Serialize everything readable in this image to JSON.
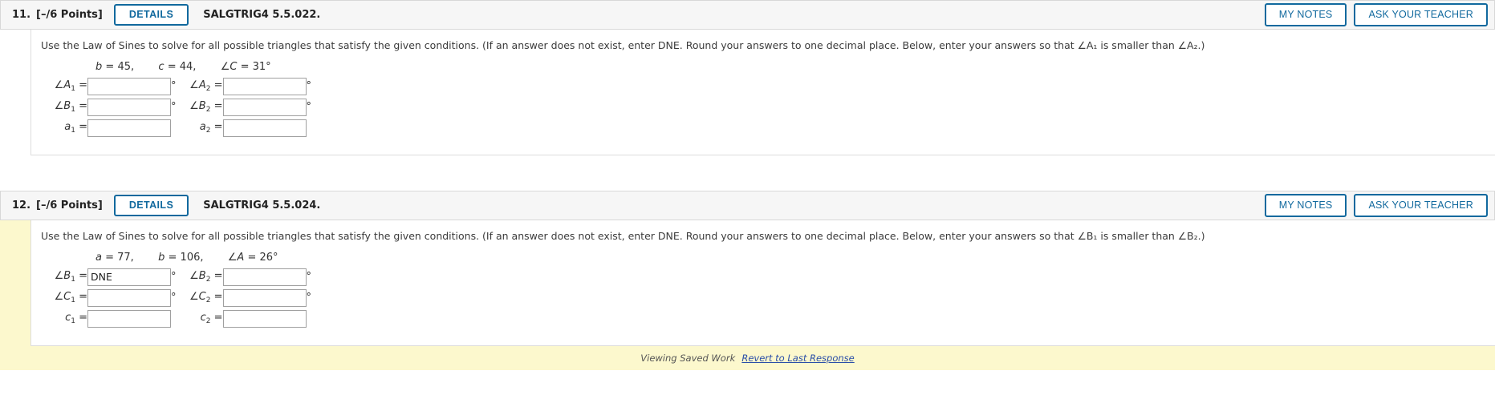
{
  "problems": [
    {
      "number": "11.",
      "points": "[–/6 Points]",
      "details_label": "DETAILS",
      "code": "SALGTRIG4 5.5.022.",
      "my_notes_label": "MY NOTES",
      "ask_teacher_label": "ASK YOUR TEACHER",
      "instructions": "Use the Law of Sines to solve for all possible triangles that satisfy the given conditions. (If an answer does not exist, enter DNE. Round your answers to one decimal place. Below, enter your answers so that ∠A₁ is smaller than ∠A₂.)",
      "given": {
        "v1_name": "b",
        "v1_value": "45,",
        "v2_name": "c",
        "v2_value": "44,",
        "v3_name": "∠C",
        "v3_value": "31°"
      },
      "state": "plain",
      "rows": [
        {
          "left_label_var": "∠A",
          "left_label_sub": "1",
          "left_value": "",
          "left_degree": "°",
          "right_label_var": "∠A",
          "right_label_sub": "2",
          "right_value": "",
          "right_degree": "°"
        },
        {
          "left_label_var": "∠B",
          "left_label_sub": "1",
          "left_value": "",
          "left_degree": "°",
          "right_label_var": "∠B",
          "right_label_sub": "2",
          "right_value": "",
          "right_degree": "°"
        },
        {
          "left_label_var": "a",
          "left_label_sub": "1",
          "left_value": "",
          "left_degree": "",
          "right_label_var": "a",
          "right_label_sub": "2",
          "right_value": "",
          "right_degree": ""
        }
      ],
      "footer": null
    },
    {
      "number": "12.",
      "points": "[–/6 Points]",
      "details_label": "DETAILS",
      "code": "SALGTRIG4 5.5.024.",
      "my_notes_label": "MY NOTES",
      "ask_teacher_label": "ASK YOUR TEACHER",
      "instructions": "Use the Law of Sines to solve for all possible triangles that satisfy the given conditions. (If an answer does not exist, enter DNE. Round your answers to one decimal place. Below, enter your answers so that ∠B₁ is smaller than ∠B₂.)",
      "given": {
        "v1_name": "a",
        "v1_value": "77,",
        "v2_name": "b",
        "v2_value": "106,",
        "v3_name": "∠A",
        "v3_value": "26°"
      },
      "state": "saved",
      "rows": [
        {
          "left_label_var": "∠B",
          "left_label_sub": "1",
          "left_value": "DNE",
          "left_degree": "°",
          "right_label_var": "∠B",
          "right_label_sub": "2",
          "right_value": "",
          "right_degree": "°"
        },
        {
          "left_label_var": "∠C",
          "left_label_sub": "1",
          "left_value": "",
          "left_degree": "°",
          "right_label_var": "∠C",
          "right_label_sub": "2",
          "right_value": "",
          "right_degree": "°"
        },
        {
          "left_label_var": "c",
          "left_label_sub": "1",
          "left_value": "",
          "left_degree": "",
          "right_label_var": "c",
          "right_label_sub": "2",
          "right_value": "",
          "right_degree": ""
        }
      ],
      "footer": {
        "status_text": "Viewing Saved Work",
        "revert_link": "Revert to Last Response"
      }
    }
  ],
  "colors": {
    "accent_blue": "#11699e",
    "saved_yellow": "#fcf8cd",
    "header_gray": "#f6f6f6",
    "link_blue": "#2a4ea8"
  }
}
